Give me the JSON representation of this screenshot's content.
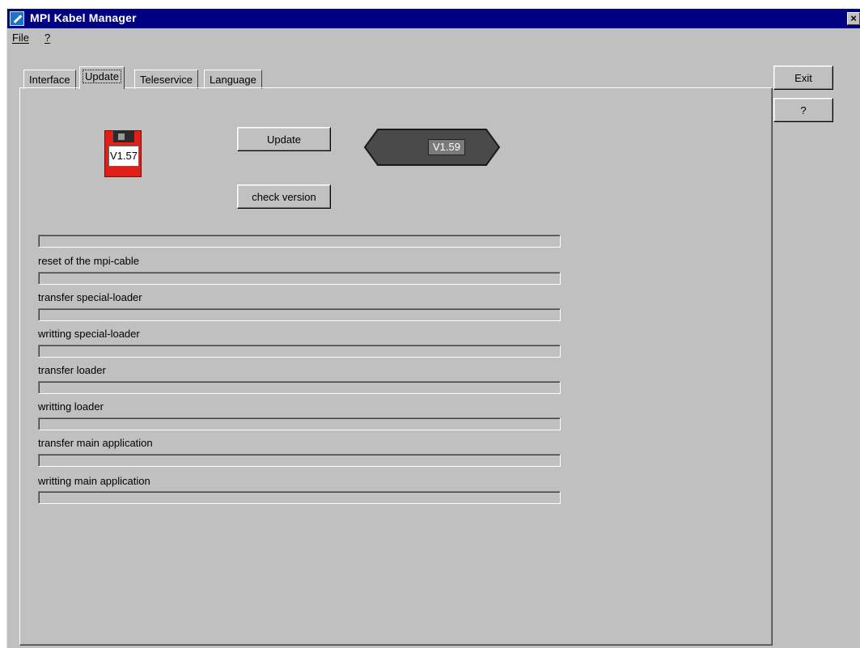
{
  "window": {
    "title": "MPI Kabel Manager",
    "close": "×"
  },
  "menu": {
    "file": "File",
    "help": "?"
  },
  "tabs": [
    {
      "label": "Interface",
      "active": false
    },
    {
      "label": "Update",
      "active": true
    },
    {
      "label": "Teleservice",
      "active": false
    },
    {
      "label": "Language",
      "active": false
    }
  ],
  "update": {
    "file_version": "V1.57",
    "device_version": "V1.59",
    "update_button": "Update",
    "check_button": "check version"
  },
  "steps": {
    "reset": "reset of the mpi-cable",
    "transfer_special": "transfer special-loader",
    "writing_special": "writting special-loader",
    "transfer_loader": "transfer loader",
    "writing_loader": "writting loader",
    "transfer_main": "transfer main application",
    "writing_main": "writting main application"
  },
  "progress": [
    0,
    0,
    0,
    0,
    0,
    0,
    0,
    0
  ],
  "side": {
    "exit": "Exit",
    "help": "?"
  }
}
